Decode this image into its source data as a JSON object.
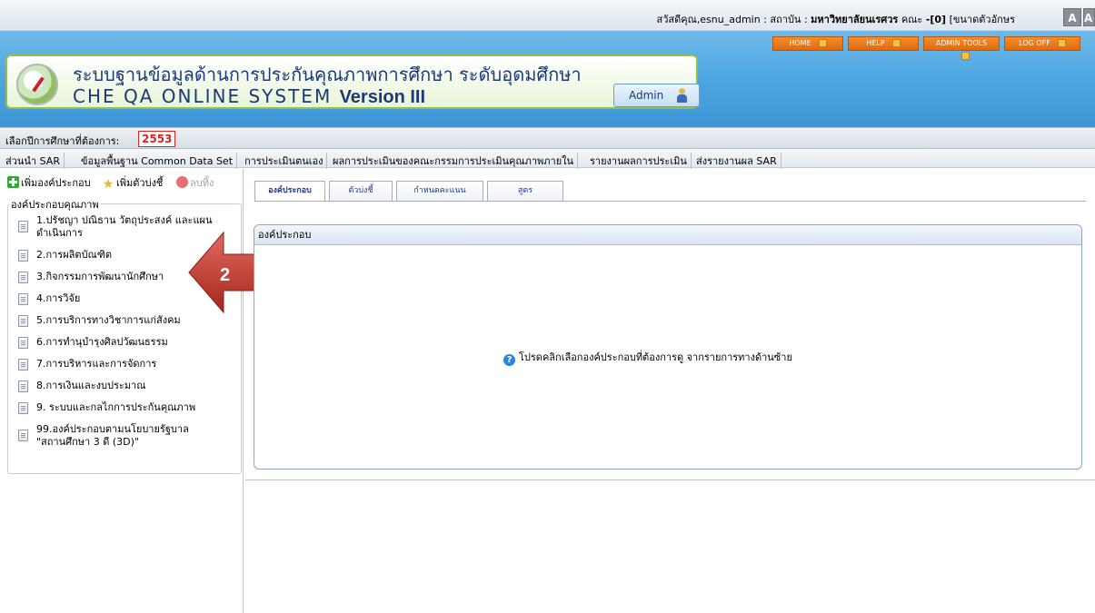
{
  "userbar": {
    "greeting": "สวัสดีคุณ,esnu_admin : สถาบัน  : ",
    "institution": "มหาวิทยาลัยนเรศวร",
    "faculty": "คณะ",
    "count": "-[0]",
    "font_size_label": "[ขนาดตัวอักษร",
    "font_small": "A",
    "font_large": "A+"
  },
  "header": {
    "nav": [
      "HOME",
      "HELP",
      "ADMIN TOOLS",
      "LOG OFF"
    ],
    "title_th": "ระบบฐานข้อมูลด้านการประกันคุณภาพการศึกษา ระดับอุดมศึกษา",
    "title_en": "CHE QA ONLINE SYSTEM",
    "version": "Version III",
    "admin_label": "Admin"
  },
  "yearbar": {
    "label": "เลือกปีการศึกษาที่ต้องการ:",
    "year": "2553"
  },
  "menu": [
    "ส่วนนำ SAR",
    "ข้อมูลพื้นฐาน Common Data Set",
    "การประเมินตนเอง",
    "ผลการประเมินของคณะกรรมการประเมินคุณภาพภายใน",
    "รายงานผลการประเมิน",
    "ส่งรายงานผล SAR"
  ],
  "toolbar": {
    "add_component": "เพิ่มองค์ประกอบ",
    "add_indicator": "เพิ่มตัวบ่งชี้",
    "delete": "ลบทิ้ง"
  },
  "tree": {
    "legend": "องค์ประกอบคุณภาพ",
    "items": [
      "1.ปรัชญา ปณิธาน วัตถุประสงค์ และแผนดำเนินการ",
      "2.การผลิตบัณฑิต",
      "3.กิจกรรมการพัฒนานักศึกษา",
      "4.การวิจัย",
      "5.การบริการทางวิชาการแก่สังคม",
      "6.การทำนุบำรุงศิลปวัฒนธรรม",
      "7.การบริหารและการจัดการ",
      "8.การเงินและงบประมาณ",
      "9. ระบบและกลไกการประกันคุณภาพ",
      "99.องค์ประกอบตามนโยบายรัฐบาล \"สถานศึกษา 3 ดี (3D)\""
    ]
  },
  "callout": {
    "number": "2"
  },
  "tabs": [
    "องค์ประกอบ",
    "ตัวบ่งชี้",
    "กำหนดคะแนน",
    "สูตร"
  ],
  "panel": {
    "header": "องค์ประกอบ",
    "message": "โปรดคลิกเลือกองค์ประกอบที่ต้องการดู จากรายการทางด้านซ้าย"
  },
  "colors": {
    "header_blue": "#4da6e0",
    "nav_orange": "#f07d20",
    "year_red": "#d22222",
    "callout_red": "#c0392b"
  }
}
